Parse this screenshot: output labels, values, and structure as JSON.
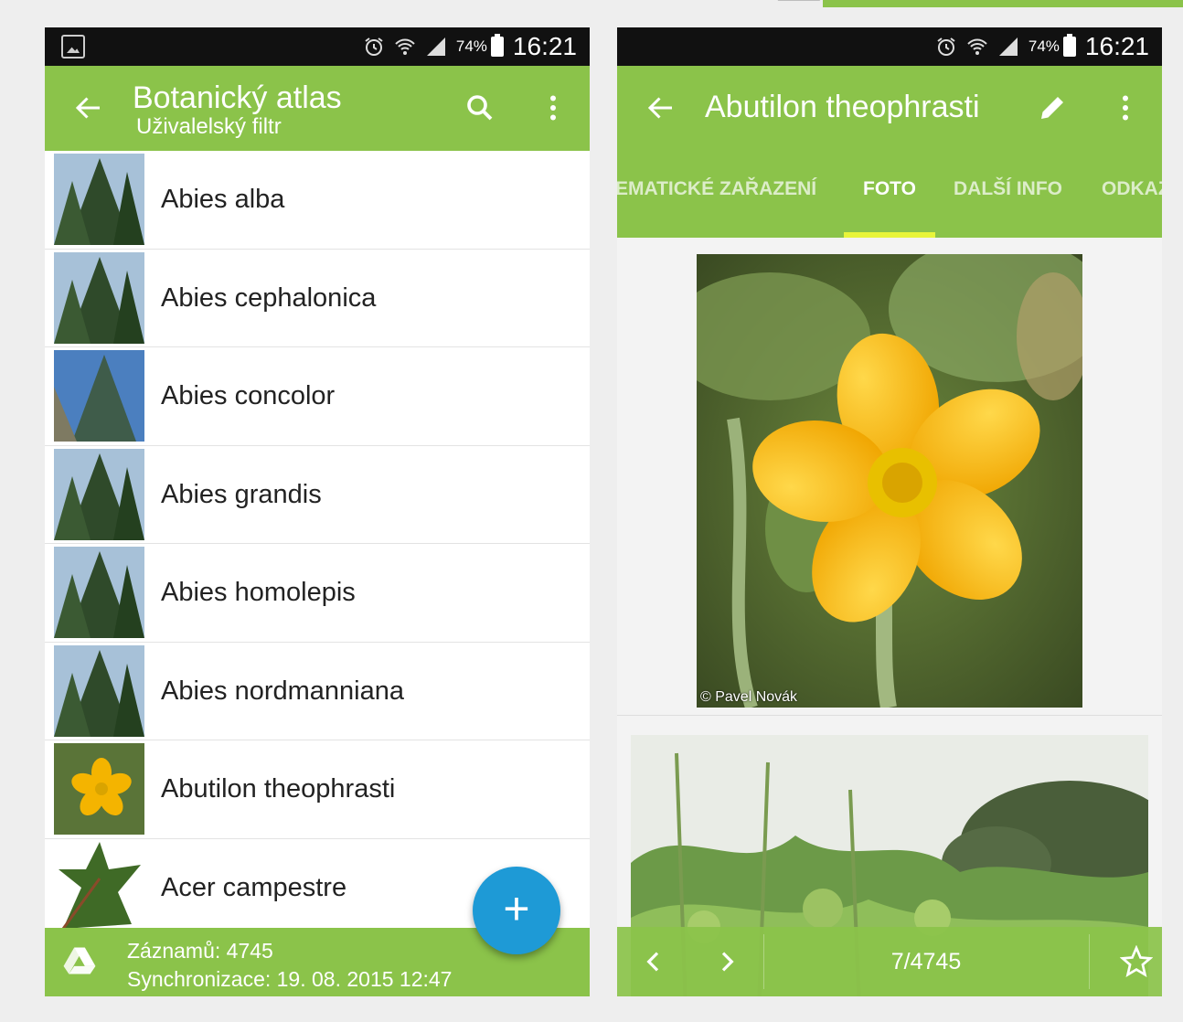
{
  "status_bar": {
    "battery": "74%",
    "time": "16:21"
  },
  "list_screen": {
    "title": "Botanický atlas",
    "subtitle": "Uživalelský filtr",
    "items": [
      {
        "label": "Abies alba",
        "thumb": "fir"
      },
      {
        "label": "Abies cephalonica",
        "thumb": "fir"
      },
      {
        "label": "Abies concolor",
        "thumb": "blue-fir"
      },
      {
        "label": "Abies grandis",
        "thumb": "fir"
      },
      {
        "label": "Abies homolepis",
        "thumb": "fir"
      },
      {
        "label": "Abies nordmanniana",
        "thumb": "fir"
      },
      {
        "label": "Abutilon theophrasti",
        "thumb": "flower"
      },
      {
        "label": "Acer campestre",
        "thumb": "leaf"
      }
    ],
    "footer": {
      "records": "Záznamů: 4745",
      "sync": "Synchronizace: 19. 08. 2015 12:47"
    },
    "fab_label": "+"
  },
  "detail_screen": {
    "title": "Abutilon theophrasti",
    "tabs": [
      "EMATICKÉ ZAŘAZENÍ",
      "FOTO",
      "DALŠÍ INFO",
      "ODKAZ"
    ],
    "active_tab": "FOTO",
    "photo_credit": "© Pavel Novák",
    "counter": "7/4745"
  },
  "colors": {
    "accent": "#8bc34a",
    "fab": "#1e9ad6",
    "tab_indicator": "#e8f53a"
  }
}
